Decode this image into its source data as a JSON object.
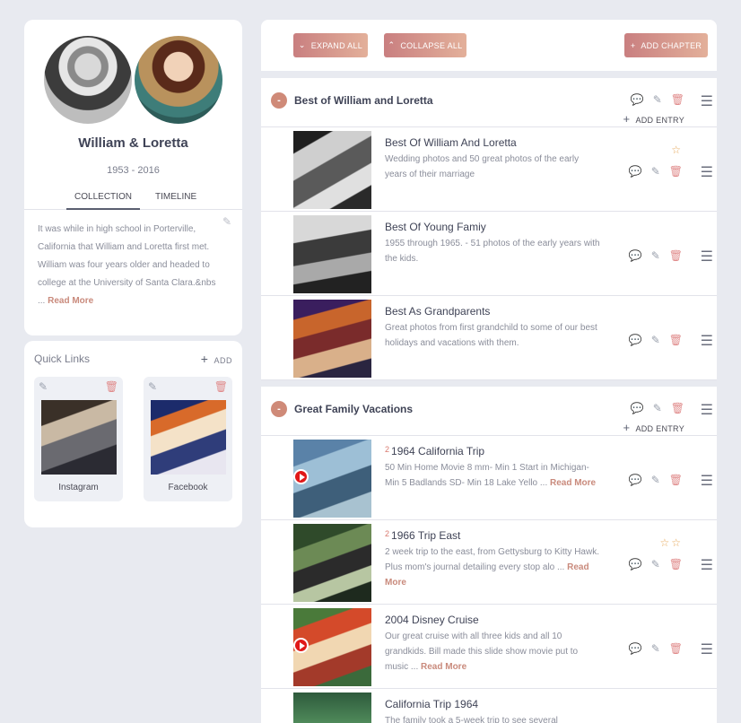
{
  "profile": {
    "name": "William & Loretta",
    "years": "1953 - 2016",
    "tabs": [
      "COLLECTION",
      "TIMELINE"
    ],
    "bio": "It was while in high school in Porterville, California that William and Loretta first met. William was four years older and headed to college at the University of Santa Clara.&nbs ...",
    "read_more": "Read More"
  },
  "quick_links": {
    "title": "Quick Links",
    "add_label": "ADD",
    "items": [
      {
        "label": "Instagram"
      },
      {
        "label": "Facebook"
      }
    ]
  },
  "toolbar": {
    "expand_label": "EXPAND ALL",
    "collapse_label": "COLLAPSE ALL",
    "add_chapter_label": "ADD CHAPTER"
  },
  "add_entry_label": "ADD ENTRY",
  "chapters": [
    {
      "title": "Best of William and Loretta",
      "toggle": "-",
      "entries": [
        {
          "title": "Best Of William And Loretta",
          "desc": "Wedding photos and 50 great photos of the early years of their marriage",
          "stars": "☆"
        },
        {
          "title": "Best Of Young Famiy",
          "desc": "1955 through 1965.  - 51 photos of the early years with the kids."
        },
        {
          "title": "Best As Grandparents",
          "desc": "Great photos from first grandchild to some of our best holidays and vacations with them."
        }
      ]
    },
    {
      "title": "Great Family Vacations",
      "toggle": "-",
      "entries": [
        {
          "count": "2",
          "title": "1964 California Trip",
          "desc": "50 Min Home Movie 8 mm- Min 1   Start in Michigan- Min 5   Badlands SD- Min 18 Lake Yello ...",
          "read_more": "Read More"
        },
        {
          "count": "2",
          "title": "1966 Trip East",
          "desc": "2 week trip to the east, from Gettysburg to Kitty Hawk.  Plus mom's journal detailing every stop alo ...",
          "read_more": "Read More",
          "stars": "☆☆"
        },
        {
          "title": "2004 Disney Cruise",
          "desc": "Our great cruise with all three kids and all 10 grandkids.  Bill made this slide show movie put to music ...",
          "read_more": "Read More"
        },
        {
          "title": "California Trip 1964",
          "desc": "The family took a 5-week trip to see several"
        }
      ]
    }
  ]
}
